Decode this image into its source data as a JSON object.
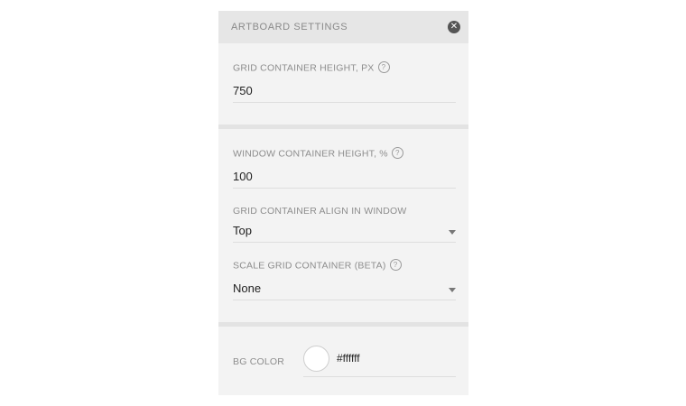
{
  "panel": {
    "title": "ARTBOARD SETTINGS",
    "close_icon": "close-icon"
  },
  "grid_height": {
    "label": "GRID CONTAINER HEIGHT, PX",
    "help_icon": "?",
    "value": "750"
  },
  "window_height": {
    "label": "WINDOW CONTAINER HEIGHT, %",
    "help_icon": "?",
    "value": "100"
  },
  "grid_align": {
    "label": "GRID CONTAINER ALIGN IN WINDOW",
    "value": "Top"
  },
  "scale": {
    "label": "SCALE GRID CONTAINER (BETA)",
    "help_icon": "?",
    "value": "None"
  },
  "bg_color": {
    "label": "BG COLOR",
    "swatch_color": "#ffffff",
    "value": "#ffffff"
  }
}
